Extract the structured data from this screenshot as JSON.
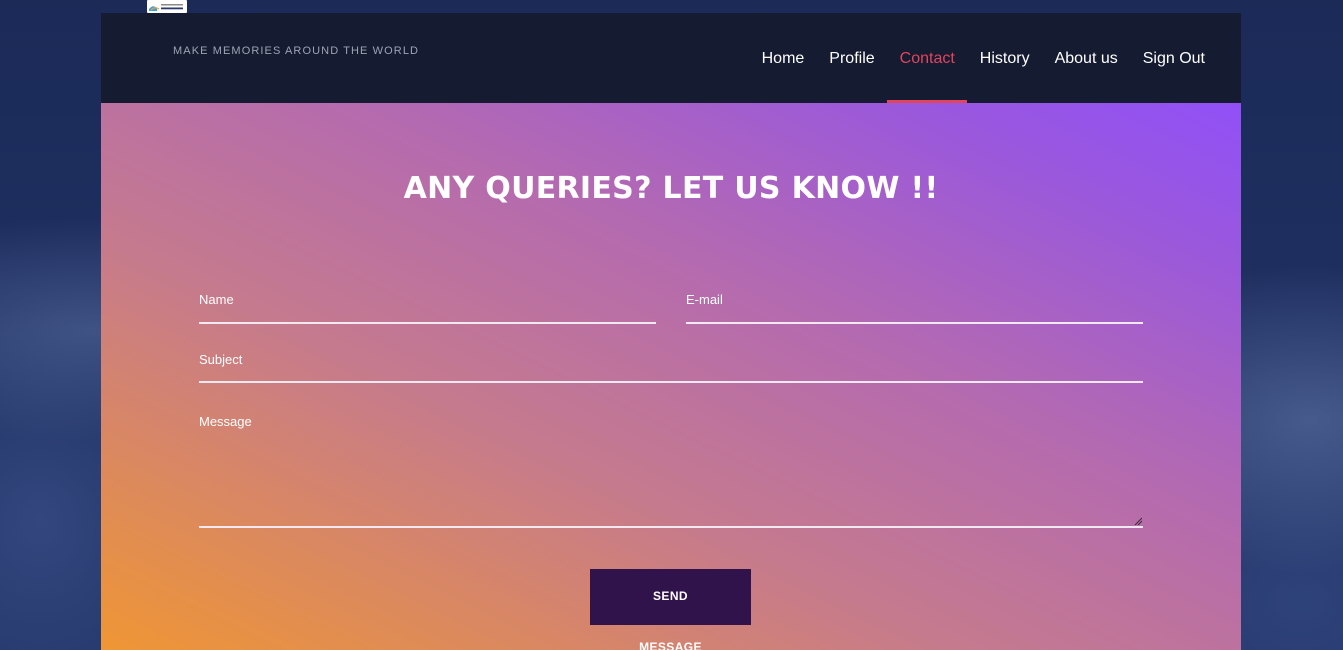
{
  "header": {
    "tagline": "MAKE MEMORIES AROUND THE WORLD",
    "logo_text": "EXPLORER",
    "nav": [
      {
        "label": "Home",
        "active": false
      },
      {
        "label": "Profile",
        "active": false
      },
      {
        "label": "Contact",
        "active": true
      },
      {
        "label": "History",
        "active": false
      },
      {
        "label": "About us",
        "active": false
      },
      {
        "label": "Sign Out",
        "active": false
      }
    ]
  },
  "contact_form": {
    "heading": "ANY QUERIES? LET US KNOW !!",
    "name_placeholder": "Name",
    "email_placeholder": "E-mail",
    "subject_placeholder": "Subject",
    "message_placeholder": "Message",
    "send_label": "SEND",
    "send_sublabel": "MESSAGE"
  },
  "colors": {
    "header_bg": "#151b31",
    "nav_active": "#e1455d",
    "button_bg": "#31134c",
    "gradient_start": "#ef9634",
    "gradient_end": "#9150f7"
  }
}
